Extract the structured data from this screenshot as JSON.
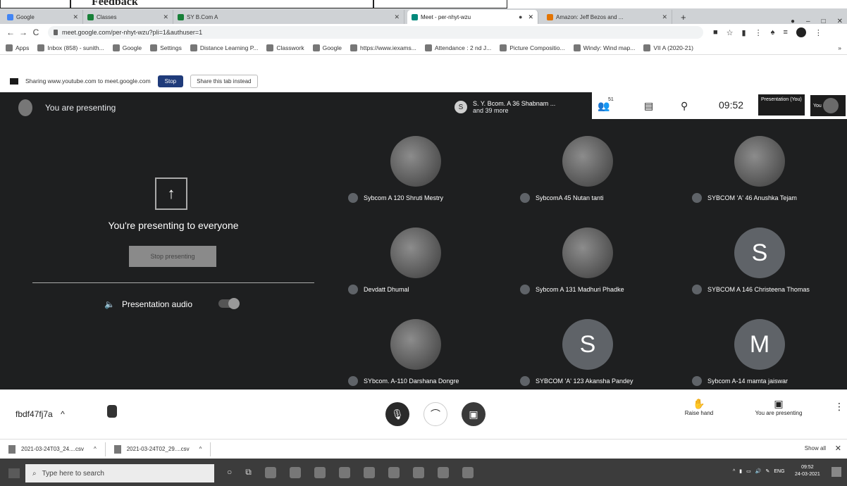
{
  "doc_heading": "Feedback",
  "tabs": [
    {
      "label": "Google",
      "color": "#4285f4"
    },
    {
      "label": "Classes",
      "color": "#188038"
    },
    {
      "label": "SY B.Com A",
      "color": "#188038"
    },
    {
      "label": "Meet - per-nhyt-wzu",
      "color": "#00897b"
    },
    {
      "label": "Amazon: Jeff Bezos and ...",
      "color": "#e37400"
    }
  ],
  "address": {
    "url": "meet.google.com/per-nhyt-wzu?pli=1&authuser=1"
  },
  "bookmarks": [
    "Apps",
    "Inbox (858) - sunith...",
    "Google",
    "Settings",
    "Distance Learning P...",
    "Classwork",
    "Google",
    "https://www.iexams...",
    "Attendance : 2 nd J...",
    "Picture Compositio...",
    "Windy: Wind map...",
    "VII A (2020-21)"
  ],
  "sharebar": {
    "text": "Sharing www.youtube.com to meet.google.com",
    "stop": "Stop",
    "share_tab": "Share this tab instead"
  },
  "meet": {
    "presenting_title": "You are presenting",
    "pinned": {
      "initial": "S",
      "name": "S. Y. Bcom. A 36 Shabnam ...",
      "more": "and 39 more"
    },
    "participant_count": "51",
    "time": "09:52",
    "presentation_tile": "Presentation (You)",
    "you_label": "You",
    "panel": {
      "everyone": "You're presenting to everyone",
      "stop_presenting": "Stop presenting",
      "audio_label": "Presentation audio"
    },
    "participants": [
      {
        "name": "Sybcom A 120 Shruti Mestry",
        "initial": ""
      },
      {
        "name": "SybcomA 45 Nutan tanti",
        "initial": ""
      },
      {
        "name": "SYBCOM 'A' 46 Anushka Tejam",
        "initial": ""
      },
      {
        "name": "Devdatt Dhumal",
        "initial": ""
      },
      {
        "name": "Sybcom A 131 Madhuri Phadke",
        "initial": ""
      },
      {
        "name": "SYBCOM A 146 Christeena Thomas",
        "initial": "S"
      },
      {
        "name": "SYbcom. A-110 Darshana Dongre",
        "initial": ""
      },
      {
        "name": "SYBCOM 'A' 123 Akansha Pandey",
        "initial": "S"
      },
      {
        "name": "Sybcom A-14 mamta jaiswar",
        "initial": "M"
      }
    ]
  },
  "controls": {
    "meeting_code": "fbdf47fj7a",
    "raise_hand": "Raise hand",
    "you_are_presenting": "You are presenting"
  },
  "downloads": {
    "files": [
      "2021-03-24T03_24....csv",
      "2021-03-24T02_29....csv"
    ],
    "show_all": "Show all"
  },
  "taskbar": {
    "search_placeholder": "Type here to search",
    "lang": "ENG",
    "time": "09:52",
    "date": "24-03-2021"
  }
}
